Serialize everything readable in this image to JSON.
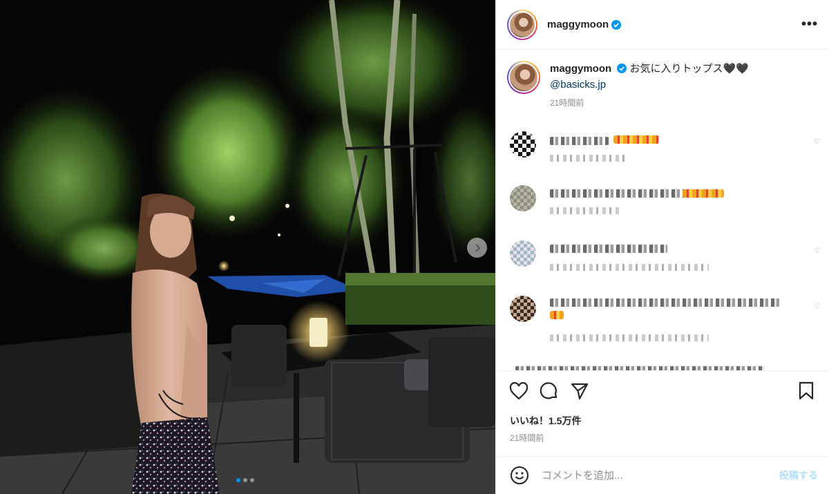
{
  "post": {
    "username": "maggymoon",
    "caption": "お気に入りトップス🖤🖤",
    "mention": "@basicks.jp",
    "caption_time": "21時間前",
    "likes": "いいね！1.5万件",
    "post_time": "21時間前"
  },
  "comment_box": {
    "placeholder": "コメントを追加...",
    "post_label": "投稿する"
  },
  "icons": {
    "verified": "verified-badge-icon",
    "more": "more-options-icon",
    "like": "heart-icon",
    "comment": "comment-bubble-icon",
    "share": "paper-plane-icon",
    "save": "bookmark-icon",
    "emoji": "smiley-icon",
    "next": "chevron-right-icon"
  },
  "carousel": {
    "slides": 3,
    "active_slide": 1
  },
  "colors": {
    "verified": "#0095f6",
    "link": "#00376b",
    "post_button": "#b2dffc",
    "muted": "#8e8e8e"
  }
}
